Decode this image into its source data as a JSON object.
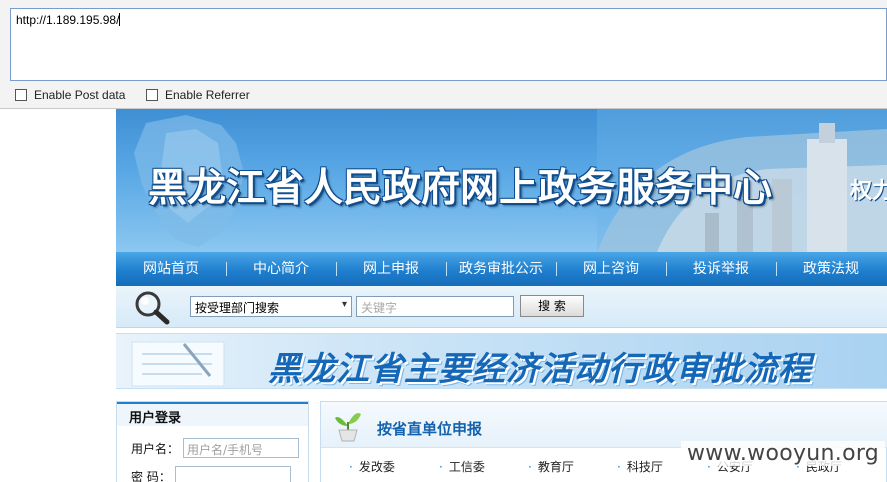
{
  "tool": {
    "url_value": "http://1.189.195.98/",
    "options": [
      {
        "label": "Enable Post data",
        "checked": false
      },
      {
        "label": "Enable Referrer",
        "checked": false
      }
    ]
  },
  "site": {
    "banner_title": "黑龙江省人民政府网上政务服务中心",
    "banner_tail": "权力",
    "nav": [
      "网站首页",
      "中心简介",
      "网上申报",
      "政务审批公示",
      "网上咨询",
      "投诉举报",
      "政策法规"
    ],
    "search": {
      "select_value": "按受理部门搜索",
      "keyword_placeholder": "关键字",
      "button_label": "搜 索"
    },
    "promo_title": "黑龙江省主要经济活动行政审批流程",
    "login": {
      "title": "用户登录",
      "username_label": "用户名：",
      "username_placeholder": "用户名/手机号",
      "password_label": "密 码："
    },
    "direct": {
      "title": "按省直单位申报",
      "departments": [
        "发改委",
        "工信委",
        "教育厅",
        "科技厅",
        "公安厅",
        "民政厅"
      ]
    }
  },
  "watermark": "www.wooyun.org",
  "colors": {
    "banner_blue": "#3e8fd4",
    "nav_blue": "#1f7fcf",
    "promo_text": "#1567b8",
    "link_blue": "#1461ad"
  },
  "icons": [
    "magnifier-icon",
    "plant-icon",
    "chevron-down-icon",
    "bullet-icon",
    "checkbox-icon"
  ]
}
